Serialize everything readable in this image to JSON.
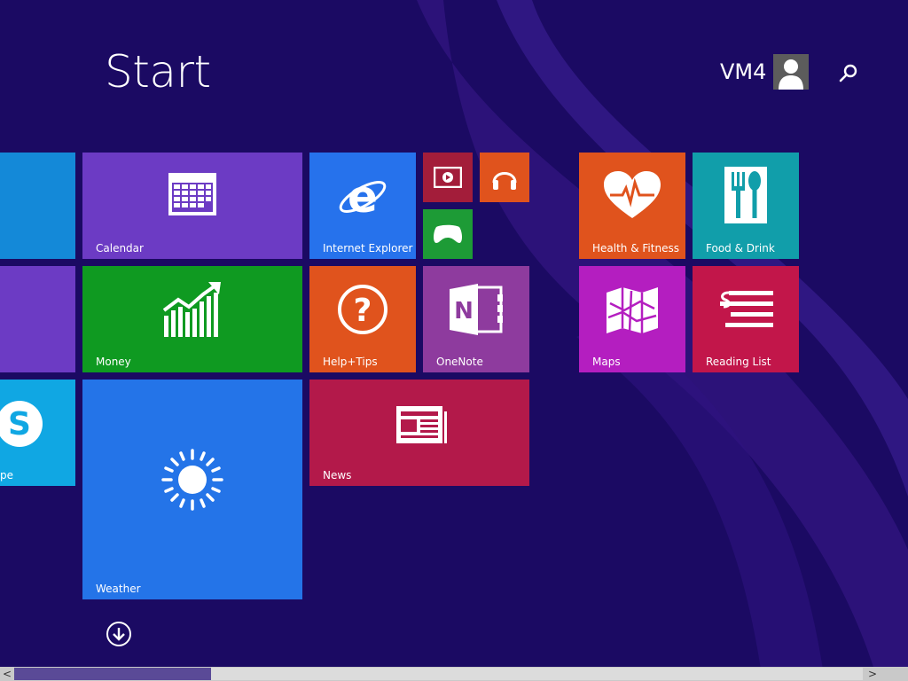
{
  "start": {
    "title": "Start"
  },
  "user": {
    "name": "VM4",
    "avatar_icon": "user-silhouette-icon"
  },
  "search": {
    "icon": "search-icon"
  },
  "tiles": {
    "calendar": {
      "label": "Calendar",
      "color": "#6c3bc4",
      "icon": "calendar-icon"
    },
    "ie": {
      "label": "Internet Explorer",
      "color": "#2672ec",
      "icon": "internet-explorer-icon"
    },
    "video": {
      "label": "",
      "color": "#a31d3a",
      "icon": "video-icon"
    },
    "music": {
      "label": "",
      "color": "#e0531d",
      "icon": "headphones-icon"
    },
    "games": {
      "label": "",
      "color": "#1d9b36",
      "icon": "xbox-controller-icon"
    },
    "health": {
      "label": "Health & Fitness",
      "color": "#e0531d",
      "icon": "heart-pulse-icon"
    },
    "food": {
      "label": "Food & Drink",
      "color": "#119eaa",
      "icon": "fork-spoon-icon"
    },
    "money": {
      "label": "Money",
      "color": "#0f9a21",
      "icon": "chart-growth-icon"
    },
    "help": {
      "label": "Help+Tips",
      "color": "#e0531d",
      "icon": "question-icon"
    },
    "onenote": {
      "label": "OneNote",
      "color": "#8e3b9e",
      "icon": "onenote-icon"
    },
    "maps": {
      "label": "Maps",
      "color": "#b41ec0",
      "icon": "map-icon"
    },
    "reading": {
      "label": "Reading List",
      "color": "#c2164a",
      "icon": "reading-list-icon"
    },
    "weather": {
      "label": "Weather",
      "color": "#2474e8",
      "icon": "sun-icon"
    },
    "news": {
      "label": "News",
      "color": "#b3194a",
      "icon": "newspaper-icon"
    },
    "skype": {
      "label": "pe",
      "color": "#10a7e3",
      "icon": "skype-icon"
    },
    "left_top": {
      "label": "",
      "color": "#1489d8"
    },
    "left_mid": {
      "label": "",
      "color": "#6c3bc4"
    }
  },
  "apps_button": {
    "icon": "arrow-down-circle-icon"
  },
  "scrollbar": {
    "left_arrow": "<",
    "right_arrow": ">"
  }
}
